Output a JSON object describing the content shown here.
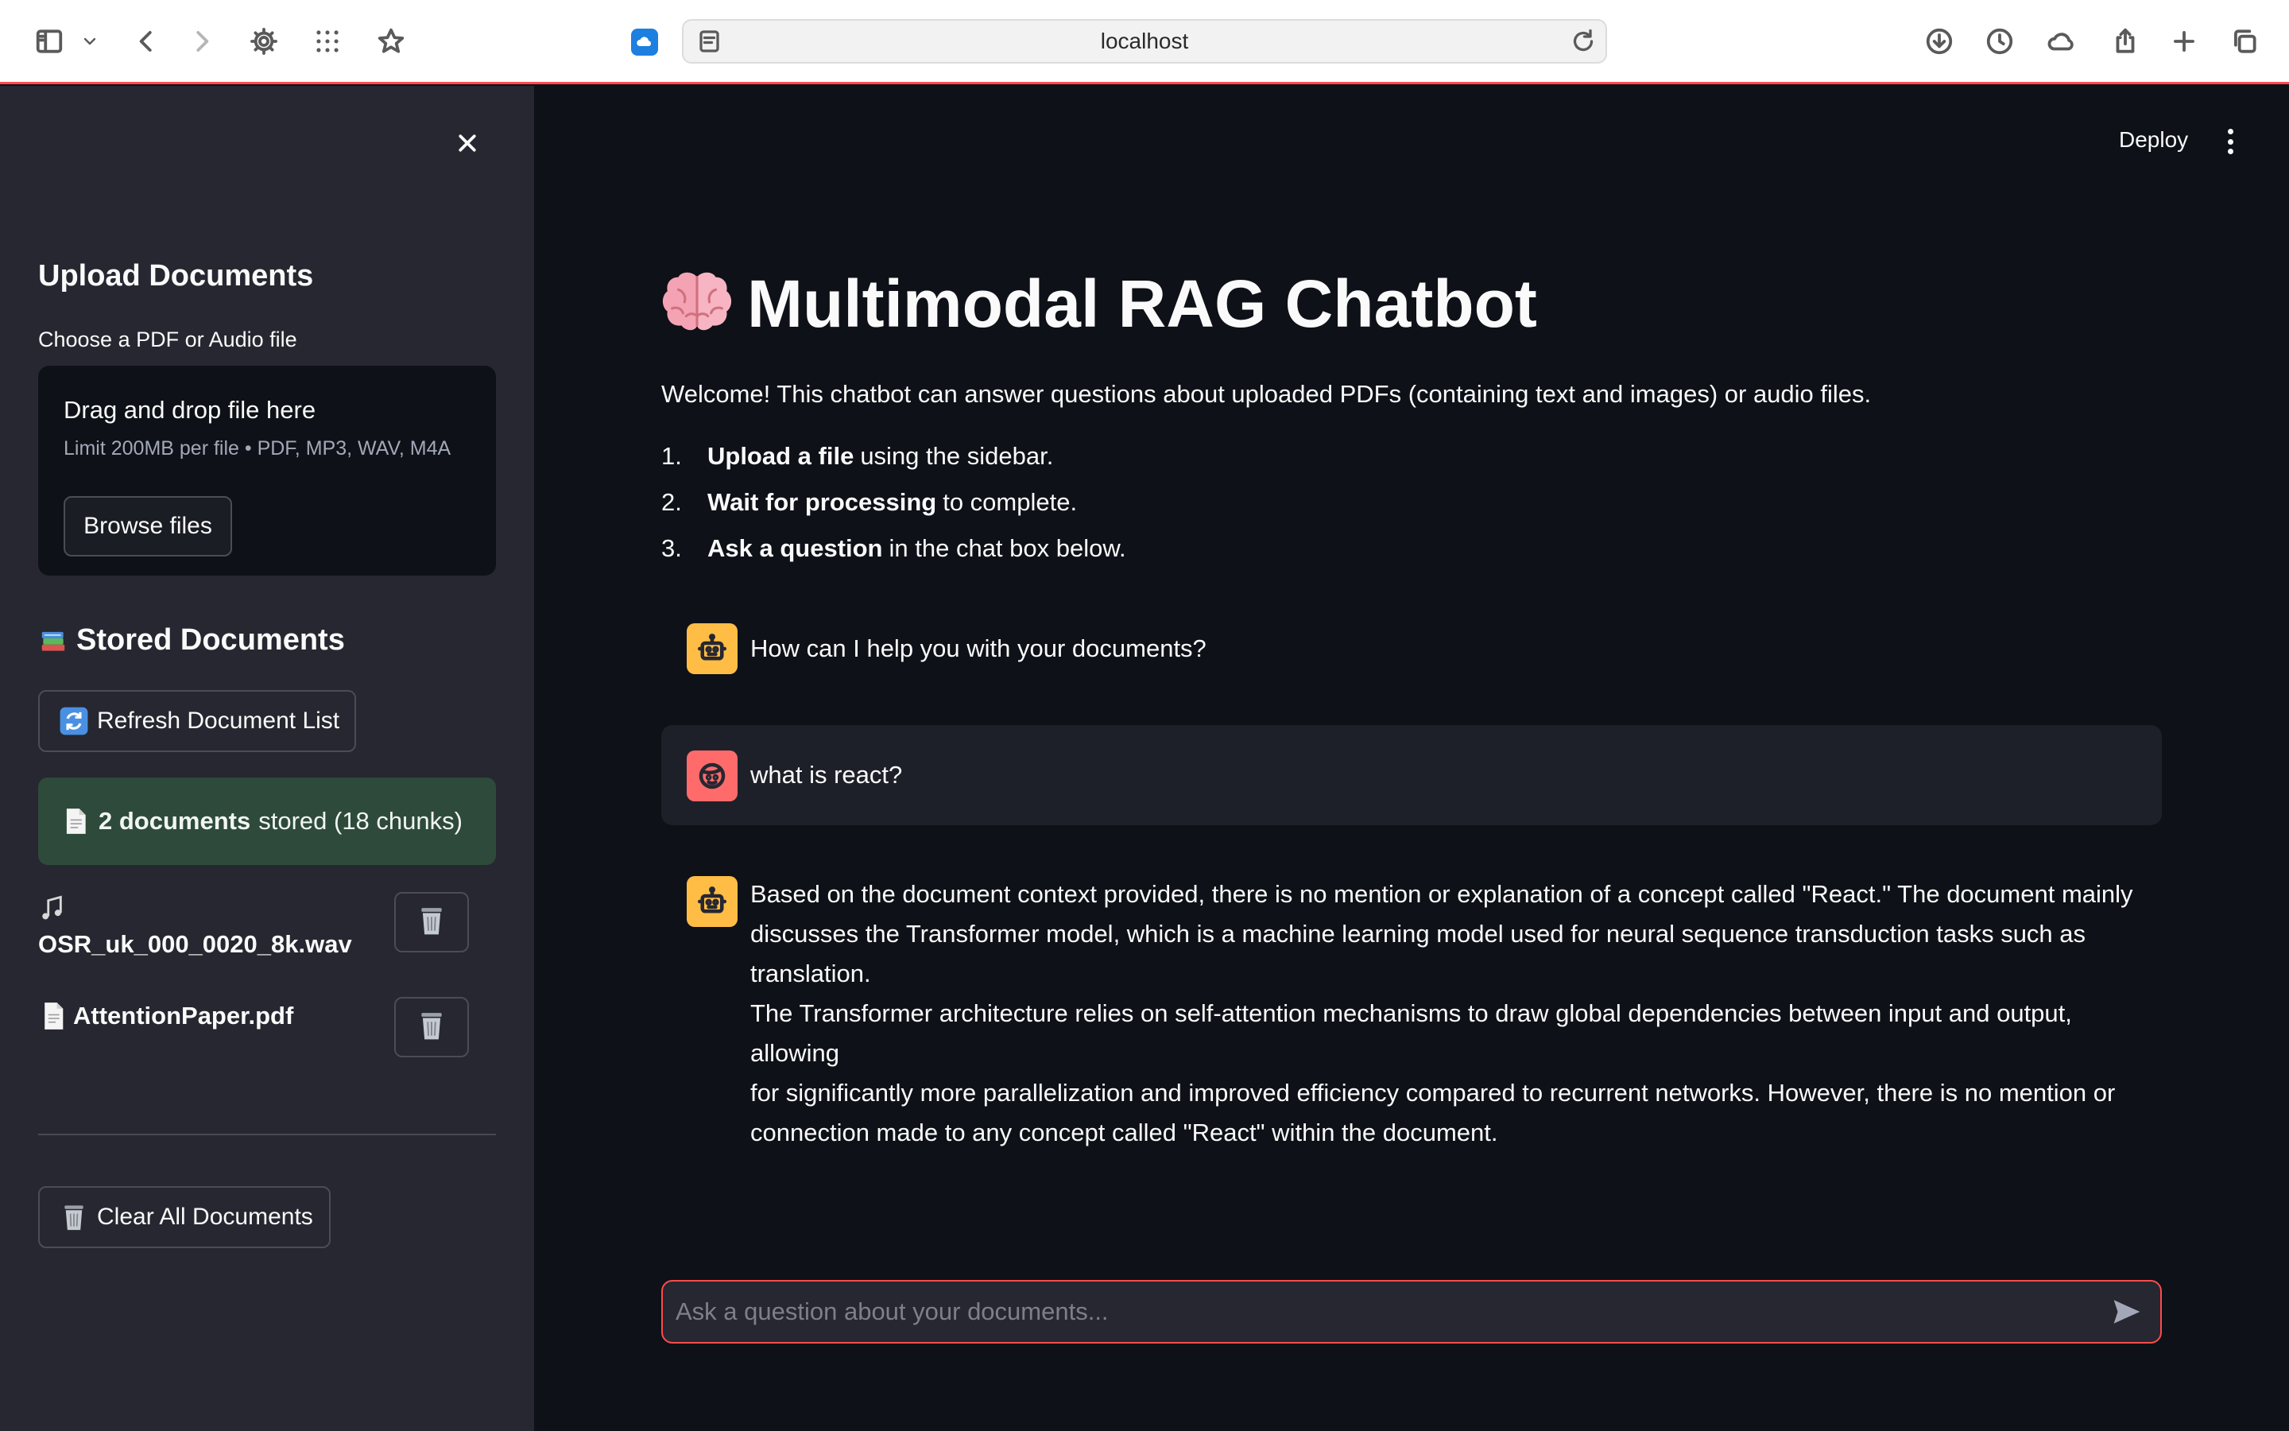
{
  "browser": {
    "address": "localhost"
  },
  "sidebar": {
    "upload_heading": "Upload Documents",
    "file_label": "Choose a PDF or Audio file",
    "dropzone_title": "Drag and drop file here",
    "dropzone_limit": "Limit 200MB per file • PDF, MP3, WAV, M4A",
    "browse_label": "Browse files",
    "stored_heading": "Stored Documents",
    "refresh_label": "Refresh Document List",
    "summary_count": "2 documents",
    "summary_rest": "stored (18 chunks)",
    "documents": [
      {
        "name": "OSR_uk_000_0020_8k.wav",
        "icon": "music-note-icon"
      },
      {
        "name": "AttentionPaper.pdf",
        "icon": "document-icon"
      }
    ],
    "clear_label": "Clear All Documents"
  },
  "header": {
    "deploy_label": "Deploy"
  },
  "main": {
    "title": "Multimodal RAG Chatbot",
    "welcome": "Welcome! This chatbot can answer questions about uploaded PDFs (containing text and images) or audio files.",
    "steps": [
      {
        "num": "1.",
        "bold": "Upload a file",
        "rest": "using the sidebar."
      },
      {
        "num": "2.",
        "bold": "Wait for processing",
        "rest": "to complete."
      },
      {
        "num": "3.",
        "bold": "Ask a question",
        "rest": "in the chat box below."
      }
    ]
  },
  "chat": {
    "messages": [
      {
        "role": "assistant",
        "text": "How can I help you with your documents?"
      },
      {
        "role": "user",
        "text": "what is react?"
      },
      {
        "role": "assistant",
        "lines": [
          "Based on the document context provided, there is no mention or explanation of a concept called \"React.\" The document mainly",
          "discusses the Transformer model, which is a machine learning model used for neural sequence transduction tasks such as translation.",
          "The Transformer architecture relies on self-attention mechanisms to draw global dependencies between input and output, allowing",
          "for significantly more parallelization and improved efficiency compared to recurrent networks. However, there is no mention or",
          "connection made to any concept called \"React\" within the document."
        ]
      }
    ],
    "input_placeholder": "Ask a question about your documents...",
    "input_value": ""
  },
  "colors": {
    "accent": "#ff4b4b",
    "sidebar_bg": "#262730",
    "main_bg": "#0e1117",
    "success_bg": "#2e4a3b",
    "bot_avatar": "#ffbd45",
    "user_avatar": "#ff6b6b"
  }
}
